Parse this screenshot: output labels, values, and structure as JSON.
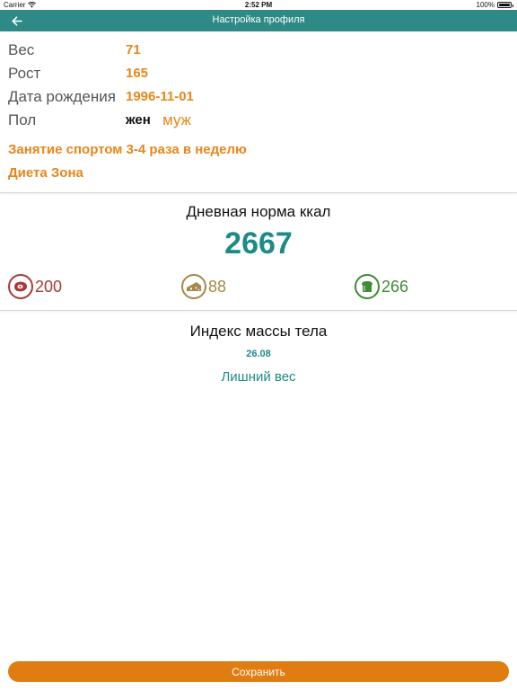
{
  "status_bar": {
    "carrier": "Carrier",
    "time": "2:52 PM",
    "battery": "100%"
  },
  "nav": {
    "title": "Настройка профиля",
    "back_icon": "arrow-left-icon"
  },
  "profile": {
    "weight": {
      "label": "Вес",
      "value": "71"
    },
    "height": {
      "label": "Рост",
      "value": "165"
    },
    "birthdate": {
      "label": "Дата рождения",
      "value": "1996-11-01"
    },
    "gender": {
      "label": "Пол",
      "female": "жен",
      "male": "муж",
      "selected": "жен"
    },
    "activity": "Занятие спортом 3-4 раза в неделю",
    "diet": "Диета Зона"
  },
  "calories": {
    "title": "Дневная норма ккал",
    "value": "2667",
    "protein": {
      "icon": "meat-icon",
      "value": "200",
      "color": "#a83a3a"
    },
    "fat": {
      "icon": "cheese-icon",
      "value": "88",
      "color": "#a8874a"
    },
    "carbs": {
      "icon": "bread-icon",
      "value": "266",
      "color": "#3f8a35"
    }
  },
  "bmi": {
    "title": "Индекс массы тела",
    "value": "26.08",
    "status": "Лишний вес"
  },
  "actions": {
    "save_label": "Сохранить"
  },
  "colors": {
    "primary": "#2e8a86",
    "accent": "#e8861a",
    "button": "#e07d12"
  }
}
